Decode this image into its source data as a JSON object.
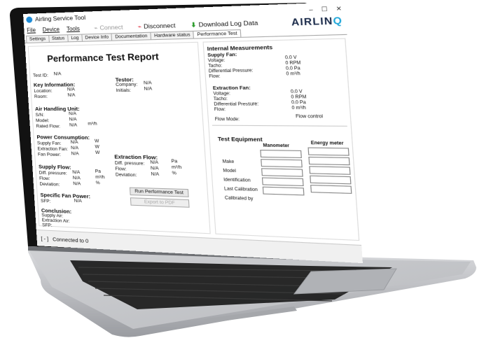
{
  "window": {
    "title": "Airling Service Tool",
    "controls": [
      "–",
      "☐",
      "✕"
    ]
  },
  "menu": {
    "items": [
      "File",
      "Device",
      "Tools"
    ]
  },
  "toolbar": {
    "connect": "Connect",
    "disconnect": "Disconnect",
    "download": "Download Log Data"
  },
  "brand": {
    "name_left": "AIRLIN",
    "name_right": "Q"
  },
  "tabs": [
    "Settings",
    "Status",
    "Log",
    "Device Info",
    "Documentation",
    "Hardware status",
    "Performance Test"
  ],
  "report": {
    "title": "Performance Test Report",
    "test_id_label": "Test ID:",
    "test_id_value": "N/A",
    "key_info": {
      "heading": "Key Information:",
      "location_label": "Location:",
      "location_value": "N/A",
      "room_label": "Room:",
      "room_value": "N/A"
    },
    "testor": {
      "heading": "Testor:",
      "company_label": "Company:",
      "company_value": "N/A",
      "initials_label": "Initials:",
      "initials_value": "N/A"
    },
    "ahu": {
      "heading": "Air Handling Unit:",
      "sn_label": "S/N:",
      "sn_value": "N/A",
      "model_label": "Model:",
      "model_value": "N/A",
      "rated_flow_label": "Rated Flow:",
      "rated_flow_value": "N/A",
      "rated_flow_unit": "m³/h"
    },
    "power": {
      "heading": "Power Consumption:",
      "supply_label": "Supply Fan:",
      "supply_value": "N/A",
      "supply_unit": "W",
      "extraction_label": "Extraction Fan:",
      "extraction_value": "N/A",
      "extraction_unit": "W",
      "fan_power_label": "Fan Power:",
      "fan_power_value": "N/A",
      "fan_power_unit": "W"
    },
    "supply_flow": {
      "heading": "Supply Flow:",
      "diff_label": "Diff. pressure:",
      "diff_value": "N/A",
      "diff_unit": "Pa",
      "flow_label": "Flow:",
      "flow_value": "N/A",
      "flow_unit": "m³/h",
      "dev_label": "Deviation:",
      "dev_value": "N/A",
      "dev_unit": "%"
    },
    "extraction_flow": {
      "heading": "Extraction Flow:",
      "diff_label": "Diff. pressure:",
      "diff_value": "N/A",
      "diff_unit": "Pa",
      "flow_label": "Flow:",
      "flow_value": "N/A",
      "flow_unit": "m³/h",
      "dev_label": "Deviation:",
      "dev_value": "N/A",
      "dev_unit": "%"
    },
    "sfp": {
      "heading": "Specific Fan Power:",
      "label": "SFP:",
      "value": "N/A"
    },
    "conclusion": {
      "heading": "Conclusion:",
      "supply_label": "Supply Air:",
      "extraction_label": "Extraction Air:",
      "sfp_label": "SFP:"
    },
    "run_button": "Run Performance Test",
    "export_button": "Export to PDF"
  },
  "internal": {
    "heading": "Internal Measurements",
    "supply_fan": {
      "heading": "Supply Fan:",
      "voltage_label": "Voltage:",
      "voltage_value": "0.0 V",
      "tacho_label": "Tacho:",
      "tacho_value": "0 RPM",
      "diff_label": "Differential Pressure:",
      "diff_value": "0.0 Pa",
      "flow_label": "Flow:",
      "flow_value": "0 m³/h"
    },
    "extraction_fan": {
      "heading": "Extraction Fan:",
      "voltage_label": "Voltage:",
      "voltage_value": "0.0 V",
      "tacho_label": "Tacho:",
      "tacho_value": "0 RPM",
      "diff_label": "Differential Pressure:",
      "diff_value": "0.0 Pa",
      "flow_label": "Flow:",
      "flow_value": "0 m³/h"
    },
    "flow_mode_label": "Flow Mode:",
    "flow_mode_value": "Flow control"
  },
  "equipment": {
    "heading": "Test Equipment",
    "col_manometer": "Manometer",
    "col_energy": "Energy meter",
    "rows": [
      "Make",
      "Model",
      "Identification",
      "Last Calibration",
      "Calibrated by"
    ]
  },
  "status": {
    "indicator": "[ - ]",
    "text": "Connected to 0"
  }
}
